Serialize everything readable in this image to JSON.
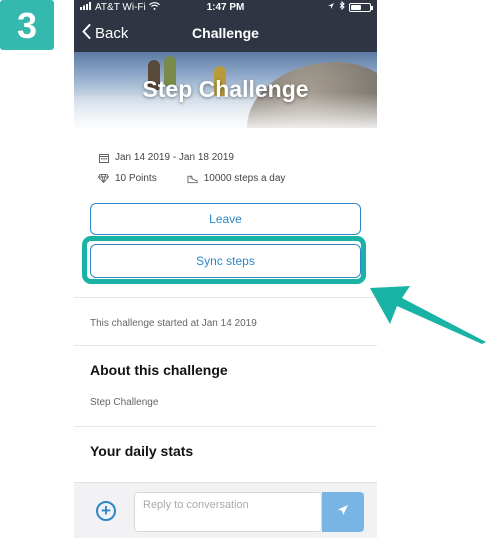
{
  "step_badge": "3",
  "status_bar": {
    "carrier": "AT&T Wi-Fi",
    "time": "1:47 PM",
    "battery_level": 0.55
  },
  "nav": {
    "back_label": "Back",
    "title": "Challenge"
  },
  "hero": {
    "title": "Step Challenge"
  },
  "challenge": {
    "date_range": "Jan 14 2019 - Jan 18 2019",
    "points": "10 Points",
    "goal": "10000 steps a day"
  },
  "buttons": {
    "leave": "Leave",
    "sync": "Sync steps"
  },
  "started_text": "This challenge started at Jan 14 2019",
  "about": {
    "title": "About this challenge",
    "description": "Step Challenge"
  },
  "stats": {
    "title": "Your daily stats"
  },
  "composer": {
    "placeholder": "Reply to conversation"
  },
  "colors": {
    "nav_bg": "#2f3542",
    "accent": "#2d88c7",
    "highlight": "#18b3a4",
    "send_bg": "#78b4e4"
  }
}
